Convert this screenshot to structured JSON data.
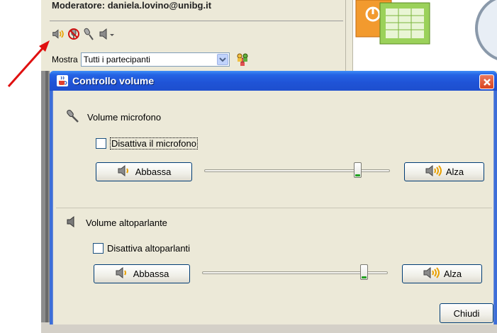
{
  "background": {
    "moderator_text": "Moderatore: daniela.lovino@unibg.it",
    "mostra_label": "Mostra",
    "mostra_value": "Tutti i partecipanti"
  },
  "dialog": {
    "title": "Controllo volume",
    "mic_section": {
      "label": "Volume microfono",
      "checkbox_label": "Disattiva il microfono",
      "checkbox_checked": false,
      "lower_label": "Abbassa",
      "raise_label": "Alza",
      "level": 0.85
    },
    "speaker_section": {
      "label": "Volume altoparlante",
      "checkbox_label": "Disattiva altoparlanti",
      "checkbox_checked": false,
      "lower_label": "Abbassa",
      "raise_label": "Alza",
      "level": 0.87
    },
    "close_label": "Chiudi"
  },
  "colors": {
    "titlebar": "#2563e4",
    "dialog_body": "#ece9d8",
    "annotation_arrow": "#e01010",
    "slider_thumb_accent": "#21a121"
  },
  "icons": [
    "speaker-volume-icon",
    "no-mic-icon",
    "microphone-icon",
    "speaker-dropdown-icon",
    "people-icon",
    "java-cup-icon",
    "close-x-icon"
  ]
}
